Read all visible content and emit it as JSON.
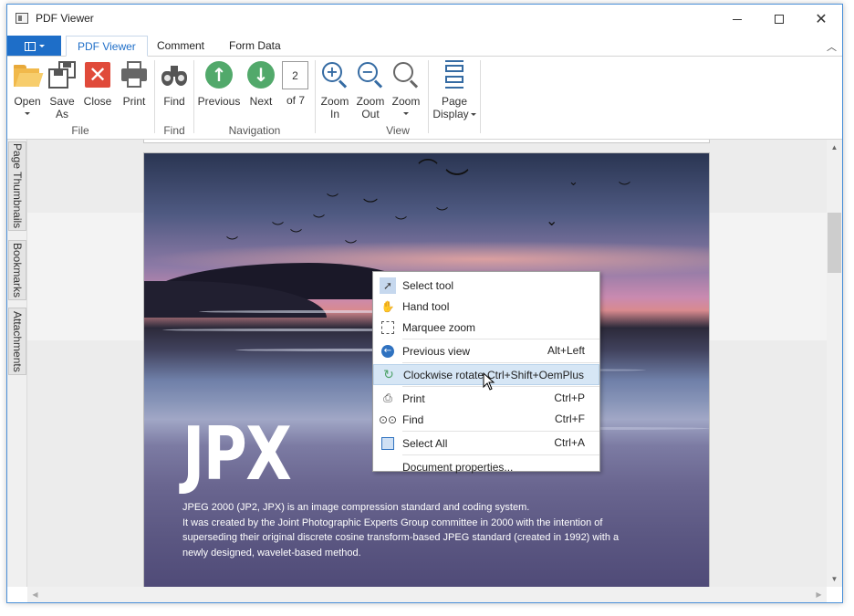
{
  "window": {
    "title": "PDF Viewer"
  },
  "tabs": [
    {
      "label": "PDF Viewer",
      "active": true
    },
    {
      "label": "Comment",
      "active": false
    },
    {
      "label": "Form Data",
      "active": false
    }
  ],
  "ribbon": {
    "file": {
      "group_label": "File",
      "open": {
        "label": "Open",
        "icon": "folder-open-icon"
      },
      "save_as": {
        "label_line1": "Save",
        "label_line2": "As",
        "icon": "save-as-icon"
      },
      "close": {
        "label": "Close",
        "icon": "close-document-icon"
      },
      "print": {
        "label": "Print",
        "icon": "printer-icon"
      }
    },
    "find": {
      "group_label": "Find",
      "find": {
        "label": "Find",
        "icon": "binoculars-icon"
      }
    },
    "navigation": {
      "group_label": "Navigation",
      "previous": {
        "label": "Previous",
        "icon": "arrow-up-circle-icon"
      },
      "next": {
        "label": "Next",
        "icon": "arrow-down-circle-icon"
      },
      "current_page": "2",
      "page_count": "of 7"
    },
    "view": {
      "group_label": "View",
      "zoom_in": {
        "label_line1": "Zoom",
        "label_line2": "In",
        "icon": "zoom-in-icon"
      },
      "zoom_out": {
        "label_line1": "Zoom",
        "label_line2": "Out",
        "icon": "zoom-out-icon"
      },
      "zoom": {
        "label": "Zoom",
        "icon": "magnifier-icon"
      },
      "page_display": {
        "label_line1": "Page",
        "label_line2": "Display",
        "icon": "page-display-icon"
      }
    }
  },
  "side_panels": [
    {
      "label": "Page Thumbnails"
    },
    {
      "label": "Bookmarks"
    },
    {
      "label": "Attachments"
    }
  ],
  "document": {
    "heading": "JPX",
    "description_lines": [
      "JPEG 2000 (JP2, JPX) is an image compression standard and coding system.",
      "It was created by the Joint Photographic Experts Group committee in 2000 with the intention of",
      "superseding their original discrete cosine transform-based JPEG standard (created in 1992) with a",
      "newly designed, wavelet-based method."
    ]
  },
  "context_menu": {
    "items": [
      {
        "label": "Select tool",
        "shortcut": "",
        "icon": "select-tool-icon"
      },
      {
        "label": "Hand tool",
        "shortcut": "",
        "icon": "hand-tool-icon"
      },
      {
        "label": "Marquee zoom",
        "shortcut": "",
        "icon": "marquee-zoom-icon"
      },
      {
        "label": "Previous view",
        "shortcut": "Alt+Left",
        "icon": "previous-view-icon"
      },
      {
        "label": "Clockwise rotate",
        "shortcut": "Ctrl+Shift+OemPlus",
        "icon": "rotate-clockwise-icon",
        "highlighted": true
      },
      {
        "label": "Print",
        "shortcut": "Ctrl+P",
        "icon": "printer-icon"
      },
      {
        "label": "Find",
        "shortcut": "Ctrl+F",
        "icon": "binoculars-icon"
      },
      {
        "label": "Select All",
        "shortcut": "Ctrl+A",
        "icon": "select-all-icon"
      },
      {
        "label": "Document properties...",
        "shortcut": "",
        "icon": ""
      }
    ]
  },
  "colors": {
    "accent": "#1e6ec8",
    "nav_green": "#52a96b",
    "close_red": "#e04a3a",
    "menu_highlight": "#d6e6f5"
  }
}
